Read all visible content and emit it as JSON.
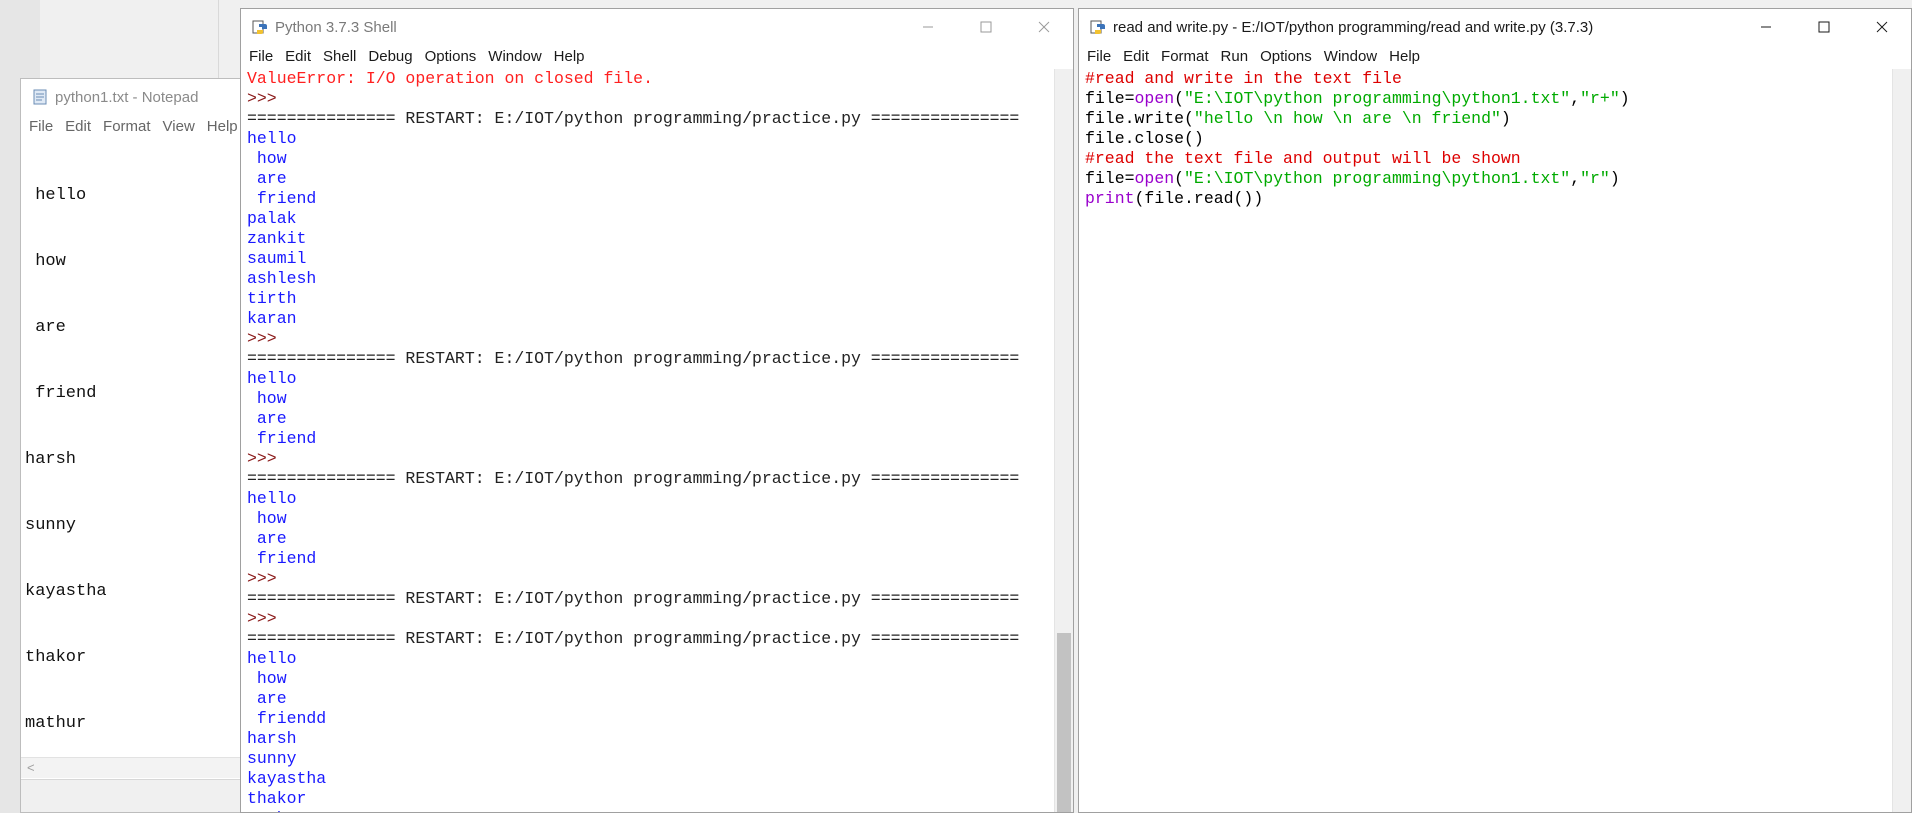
{
  "notepad": {
    "title": "python1.txt - Notepad",
    "menu": [
      "File",
      "Edit",
      "Format",
      "View",
      "Help"
    ],
    "lines": [
      " hello",
      " how",
      " are",
      " friend",
      "harsh",
      "sunny",
      "kayastha",
      "thakor",
      "mathur"
    ]
  },
  "shell": {
    "title": "Python 3.7.3 Shell",
    "menu": [
      "File",
      "Edit",
      "Shell",
      "Debug",
      "Options",
      "Window",
      "Help"
    ],
    "lines": [
      {
        "text": "ValueError: I/O operation on closed file.",
        "kind": "err"
      },
      {
        "text": ">>> ",
        "kind": "prompt"
      },
      {
        "text": "=============== RESTART: E:/IOT/python programming/practice.py ===============",
        "kind": "rule"
      },
      {
        "text": "hello",
        "kind": "out"
      },
      {
        "text": " how",
        "kind": "out"
      },
      {
        "text": " are",
        "kind": "out"
      },
      {
        "text": " friend",
        "kind": "out"
      },
      {
        "text": "palak",
        "kind": "out"
      },
      {
        "text": "zankit",
        "kind": "out"
      },
      {
        "text": "saumil",
        "kind": "out"
      },
      {
        "text": "ashlesh",
        "kind": "out"
      },
      {
        "text": "tirth",
        "kind": "out"
      },
      {
        "text": "karan",
        "kind": "out"
      },
      {
        "text": ">>> ",
        "kind": "prompt"
      },
      {
        "text": "=============== RESTART: E:/IOT/python programming/practice.py ===============",
        "kind": "rule"
      },
      {
        "text": "hello",
        "kind": "out"
      },
      {
        "text": " how",
        "kind": "out"
      },
      {
        "text": " are",
        "kind": "out"
      },
      {
        "text": " friend",
        "kind": "out"
      },
      {
        "text": ">>> ",
        "kind": "prompt"
      },
      {
        "text": "=============== RESTART: E:/IOT/python programming/practice.py ===============",
        "kind": "rule"
      },
      {
        "text": "hello",
        "kind": "out"
      },
      {
        "text": " how",
        "kind": "out"
      },
      {
        "text": " are",
        "kind": "out"
      },
      {
        "text": " friend",
        "kind": "out"
      },
      {
        "text": ">>> ",
        "kind": "prompt"
      },
      {
        "text": "=============== RESTART: E:/IOT/python programming/practice.py ===============",
        "kind": "rule"
      },
      {
        "text": ">>> ",
        "kind": "prompt"
      },
      {
        "text": "=============== RESTART: E:/IOT/python programming/practice.py ===============",
        "kind": "rule"
      },
      {
        "text": "hello",
        "kind": "out"
      },
      {
        "text": " how",
        "kind": "out"
      },
      {
        "text": " are",
        "kind": "out"
      },
      {
        "text": " friendd",
        "kind": "out"
      },
      {
        "text": "harsh",
        "kind": "out"
      },
      {
        "text": "sunny",
        "kind": "out"
      },
      {
        "text": "kayastha",
        "kind": "out"
      },
      {
        "text": "thakor",
        "kind": "out"
      },
      {
        "text": "mathur",
        "kind": "out"
      }
    ]
  },
  "editor": {
    "title": "read and write.py - E:/IOT/python programming/read and write.py (3.7.3)",
    "menu": [
      "File",
      "Edit",
      "Format",
      "Run",
      "Options",
      "Window",
      "Help"
    ],
    "lines": [
      [
        {
          "t": "#read and write in the text file",
          "c": "comment"
        }
      ],
      [
        {
          "t": "file=",
          "c": "def"
        },
        {
          "t": "open",
          "c": "builtin"
        },
        {
          "t": "(",
          "c": "def"
        },
        {
          "t": "\"E:\\IOT\\python programming\\python1.txt\"",
          "c": "string"
        },
        {
          "t": ",",
          "c": "def"
        },
        {
          "t": "\"r+\"",
          "c": "string"
        },
        {
          "t": ")",
          "c": "def"
        }
      ],
      [
        {
          "t": "file.write(",
          "c": "def"
        },
        {
          "t": "\"hello \\n how \\n are \\n friend\"",
          "c": "string"
        },
        {
          "t": ")",
          "c": "def"
        }
      ],
      [
        {
          "t": "file.close()",
          "c": "def"
        }
      ],
      [
        {
          "t": "#read the text file and output will be shown",
          "c": "comment"
        }
      ],
      [
        {
          "t": "file=",
          "c": "def"
        },
        {
          "t": "open",
          "c": "builtin"
        },
        {
          "t": "(",
          "c": "def"
        },
        {
          "t": "\"E:\\IOT\\python programming\\python1.txt\"",
          "c": "string"
        },
        {
          "t": ",",
          "c": "def"
        },
        {
          "t": "\"r\"",
          "c": "string"
        },
        {
          "t": ")",
          "c": "def"
        }
      ],
      [
        {
          "t": "print",
          "c": "builtin"
        },
        {
          "t": "(file.read())",
          "c": "def"
        }
      ]
    ]
  },
  "icons": {
    "minimize": "minimize-icon",
    "maximize": "maximize-icon",
    "close": "close-icon",
    "app": "python-idle-icon",
    "notepad": "notepad-icon"
  }
}
